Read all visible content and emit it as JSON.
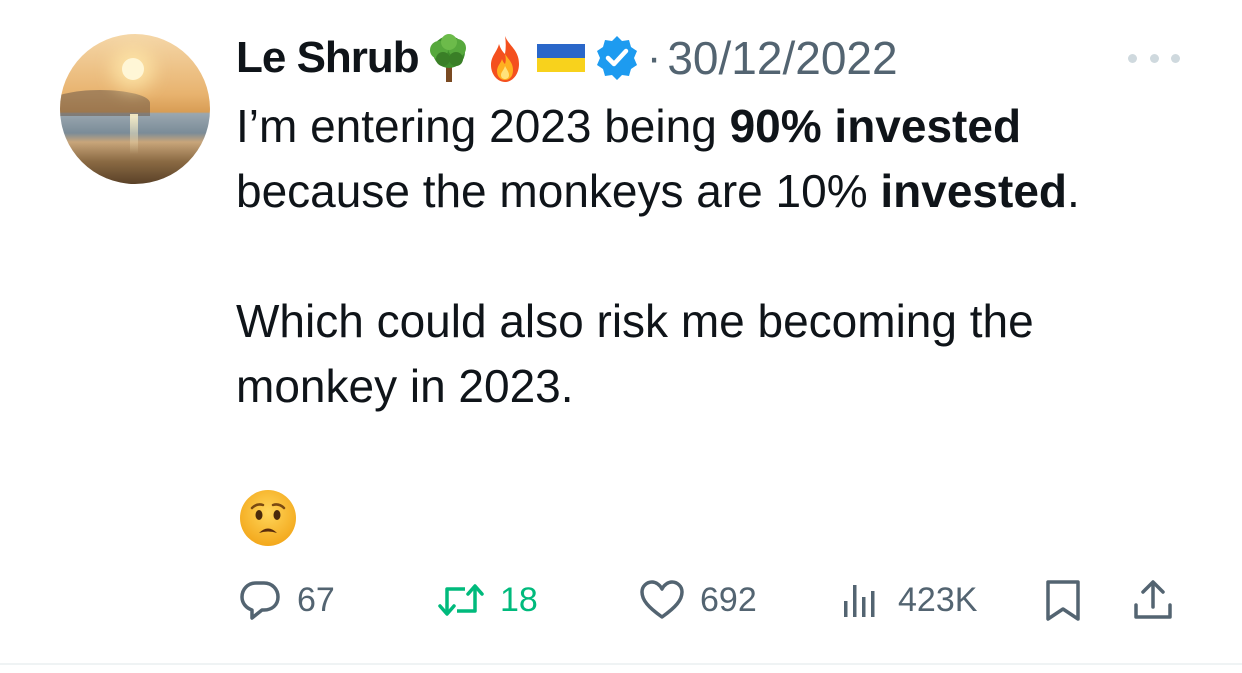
{
  "author": {
    "name": "Le Shrub",
    "badges": [
      "tree-emoji",
      "fire-emoji",
      "ukraine-flag-emoji",
      "verified-badge-icon"
    ],
    "separator": "·",
    "date": "30/12/2022"
  },
  "tweet": {
    "line1_pre": "I’m entering 2023 being ",
    "line1_bold": "90% invested",
    "line2_pre": "because the monkeys are 10% ",
    "line2_bold": "invested",
    "line2_post": ".",
    "para2": "Which could also risk me becoming the monkey in 2023.",
    "emoji": "worried-face-emoji"
  },
  "actions": {
    "replies": "67",
    "retweets": "18",
    "likes": "692",
    "views": "423K"
  },
  "colors": {
    "text": "#0f1419",
    "muted": "#536471",
    "retweet_green": "#00ba7c",
    "verified_blue": "#1d9bf0"
  }
}
